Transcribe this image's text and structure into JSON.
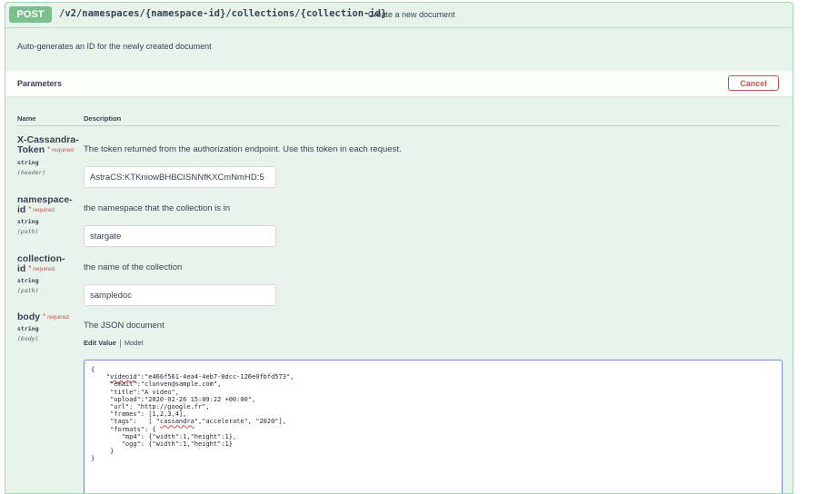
{
  "operation": {
    "method": "POST",
    "path": "/v2/namespaces/{namespace-id}/collections/{collection-id}",
    "summary": "Create a new document",
    "description": "Auto-generates an ID for the newly created document"
  },
  "parameters": {
    "title": "Parameters",
    "cancel_label": "Cancel",
    "col_name": "Name",
    "col_description": "Description",
    "items": [
      {
        "name_line1": "X-Cassandra-",
        "name_line2": "Token",
        "required": "required",
        "type": "string",
        "in": "(header)",
        "description": "The token returned from the authorization endpoint. Use this token in each request.",
        "value": "AstraCS:KTKniowBHBCISNNfKXCmNmHD:5"
      },
      {
        "name_line1": "namespace-",
        "name_line2": "id",
        "required": "required",
        "type": "string",
        "in": "(path)",
        "description": "the namespace that the collection is in",
        "value": "stargate"
      },
      {
        "name_line1": "collection-",
        "name_line2": "id",
        "required": "required",
        "type": "string",
        "in": "(path)",
        "description": "the name of the collection",
        "value": "sampledoc"
      },
      {
        "name_line1": "body",
        "required": "required",
        "type": "string",
        "in": "(body)",
        "description": "The JSON document"
      }
    ]
  },
  "body_editor": {
    "tab_edit": "Edit Value",
    "tab_model": "Model",
    "lines": [
      "{",
      "    \"videoid\":\"e466f561-4ea4-4eb7-8dcc-126e0fbfd573\",",
      "     \"email\":\"clunven@sample.com\",",
      "     \"title\":\"A video\",",
      "     \"upload\":\"2020-02-26 15:09:22 +00:00\",",
      "     \"url\": \"http://google.fr\",",
      "     \"frames\": [1,2,3,4],",
      "     \"tags\":   [ \"cassandra\",\"accelerate\", \"2020\"],",
      "     \"formats\": {",
      "        \"mp4\": {\"width\":1,\"height\":1},",
      "        \"ogg\": {\"width\":1,\"height\":1}",
      "     }",
      "}"
    ]
  },
  "colors": {
    "method_green": "#7bbf8e",
    "panel_bg": "#e8f3ec",
    "cancel_red": "#c0574f",
    "editor_border": "#7c93d8"
  }
}
